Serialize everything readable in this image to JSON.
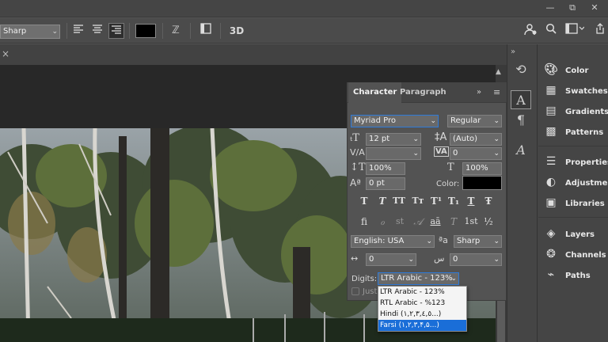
{
  "window": {
    "minimize_glyph": "—",
    "restore_glyph": "⧉",
    "close_glyph": "✕"
  },
  "options_bar": {
    "aa_method": "Sharp",
    "align_left_icon": "text-align-left-icon",
    "align_center_icon": "text-align-center-icon",
    "align_right_icon": "text-align-right-icon",
    "text_color": "#000000",
    "warp_glyph": "ℤ",
    "label_3d": "3D"
  },
  "doc_tab": {
    "close_glyph": "×"
  },
  "dock_strip": {
    "collapse_glyph": "»",
    "expand_glyph": "«"
  },
  "character_panel": {
    "tabs": [
      "Character",
      "Paragraph"
    ],
    "menu_glyph": "≡",
    "collapse_glyph": "»",
    "font_family": "Myriad Pro",
    "font_style": "Regular",
    "font_size": "12 pt",
    "leading": "(Auto)",
    "kerning": "",
    "tracking": "0",
    "vertical_scale": "100%",
    "horizontal_scale": "100%",
    "baseline_shift": "0 pt",
    "color_label": "Color:",
    "color_value": "#000000",
    "style_buttons": [
      "T",
      "T",
      "TT",
      "Tт",
      "T¹",
      "T₁",
      "T",
      "Ŧ"
    ],
    "opentype_buttons": [
      "ﬁ",
      "ℴ",
      "st",
      "𝒜",
      "aā",
      "T",
      "1st",
      "½"
    ],
    "language": "English: USA",
    "aa": "Sharp",
    "kashida_left": "0",
    "kashida_right": "0",
    "digits_label": "Digits:",
    "digits_value": "LTR Arabic - 123%",
    "justify_partial": "Just"
  },
  "digits_dropdown": {
    "options": [
      "LTR Arabic - 123%",
      "RTL Arabic - %123",
      "Hindi (١,٢,٣,٤,٥...)",
      "Farsi (١,٢,٣,۴,۵...)"
    ],
    "highlighted_index": 3
  },
  "right_panels": [
    {
      "label": "Color",
      "icon": "palette-icon"
    },
    {
      "label": "Swatches",
      "icon": "grid-icon"
    },
    {
      "label": "Gradients",
      "icon": "gradient-icon"
    },
    {
      "label": "Patterns",
      "icon": "pattern-icon"
    },
    {
      "label": "Properties",
      "icon": "sliders-icon"
    },
    {
      "label": "Adjustme...",
      "icon": "adjust-icon"
    },
    {
      "label": "Libraries",
      "icon": "library-icon"
    },
    {
      "label": "Layers",
      "icon": "layers-icon"
    },
    {
      "label": "Channels",
      "icon": "channels-icon"
    },
    {
      "label": "Paths",
      "icon": "paths-icon"
    }
  ]
}
